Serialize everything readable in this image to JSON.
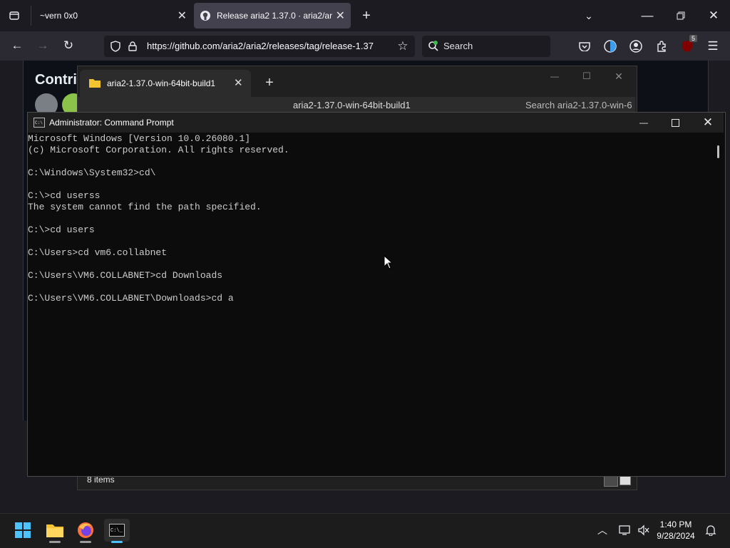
{
  "browser": {
    "tabs": [
      {
        "label": "~vern 0x0"
      },
      {
        "label": "Release aria2 1.37.0 · aria2/aria2"
      }
    ],
    "url": "https://github.com/aria2/aria2/releases/tag/release-1.37",
    "search_placeholder": "Search",
    "extension_badge": "5",
    "page_heading": "Contri"
  },
  "explorer": {
    "tab_label": "aria2-1.37.0-win-64bit-build1",
    "address": "aria2-1.37.0-win-64bit-build1",
    "search_placeholder": "Search aria2-1.37.0-win-6",
    "status": "8 items"
  },
  "cmd": {
    "title": "Administrator: Command Prompt",
    "output": "Microsoft Windows [Version 10.0.26080.1]\n(c) Microsoft Corporation. All rights reserved.\n\nC:\\Windows\\System32>cd\\\n\nC:\\>cd userss\nThe system cannot find the path specified.\n\nC:\\>cd users\n\nC:\\Users>cd vm6.collabnet\n\nC:\\Users\\VM6.COLLABNET>cd Downloads\n\nC:\\Users\\VM6.COLLABNET\\Downloads>cd a"
  },
  "taskbar": {
    "time": "1:40 PM",
    "date": "9/28/2024"
  }
}
